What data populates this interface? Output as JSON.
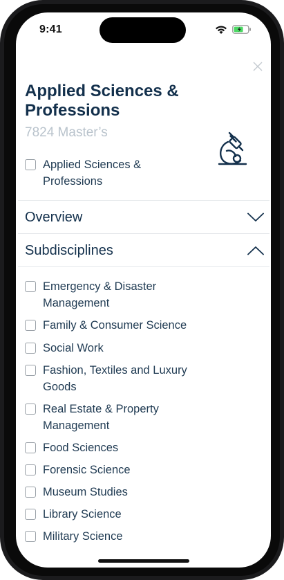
{
  "status_bar": {
    "time": "9:41"
  },
  "header": {
    "title": "Applied Sciences & Professions",
    "subtitle": "7824 Master’s",
    "main_checkbox_label": "Applied Sciences & Professions"
  },
  "sections": {
    "overview": "Overview",
    "subdisciplines": "Subdisciplines"
  },
  "subdisciplines": [
    "Emergency & Disaster Management",
    "Family & Consumer Science",
    "Social Work",
    "Fashion, Textiles and Luxury Goods",
    "Real Estate & Property Management",
    "Food Sciences",
    "Forensic Science",
    "Museum Studies",
    "Library Science",
    "Military Science"
  ],
  "colors": {
    "primary_text": "#13304c",
    "muted_text": "#b9c3cc",
    "divider": "#e4e7ea",
    "battery": "#4cd964"
  }
}
